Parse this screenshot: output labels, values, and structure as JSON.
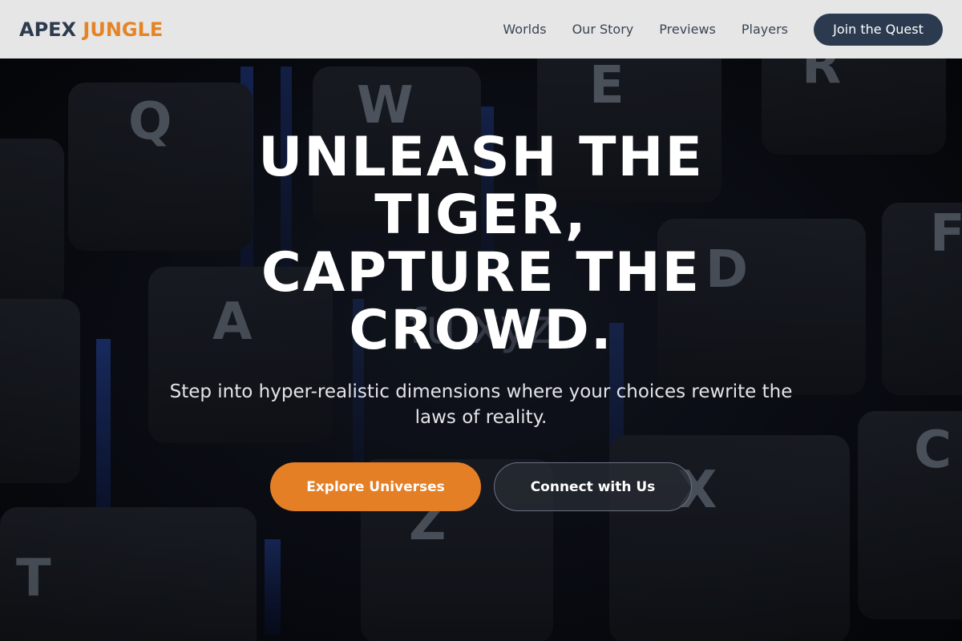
{
  "header": {
    "logo_part1": "APEX",
    "logo_part2": "JUNGLE",
    "nav": [
      "Worlds",
      "Our Story",
      "Previews",
      "Players"
    ],
    "cta_label": "Join the Quest"
  },
  "hero": {
    "headline_lines": [
      "UNLEASH THE",
      "TIGER,",
      "CAPTURE THE",
      "CROWD."
    ],
    "subtitle": "Step into hyper-realistic dimensions where your choices rewrite the laws of reality.",
    "primary_button": "Explore Universes",
    "secondary_button": "Connect with Us",
    "watermark_text": "fu        xyz",
    "background_keys": [
      "Q",
      "W",
      "E",
      "R",
      "A",
      "D",
      "F",
      "Z",
      "X",
      "T",
      "C"
    ]
  },
  "colors": {
    "accent": "#e47f26",
    "header_bg": "#e6e6e6",
    "navy": "#2b3a4f"
  }
}
